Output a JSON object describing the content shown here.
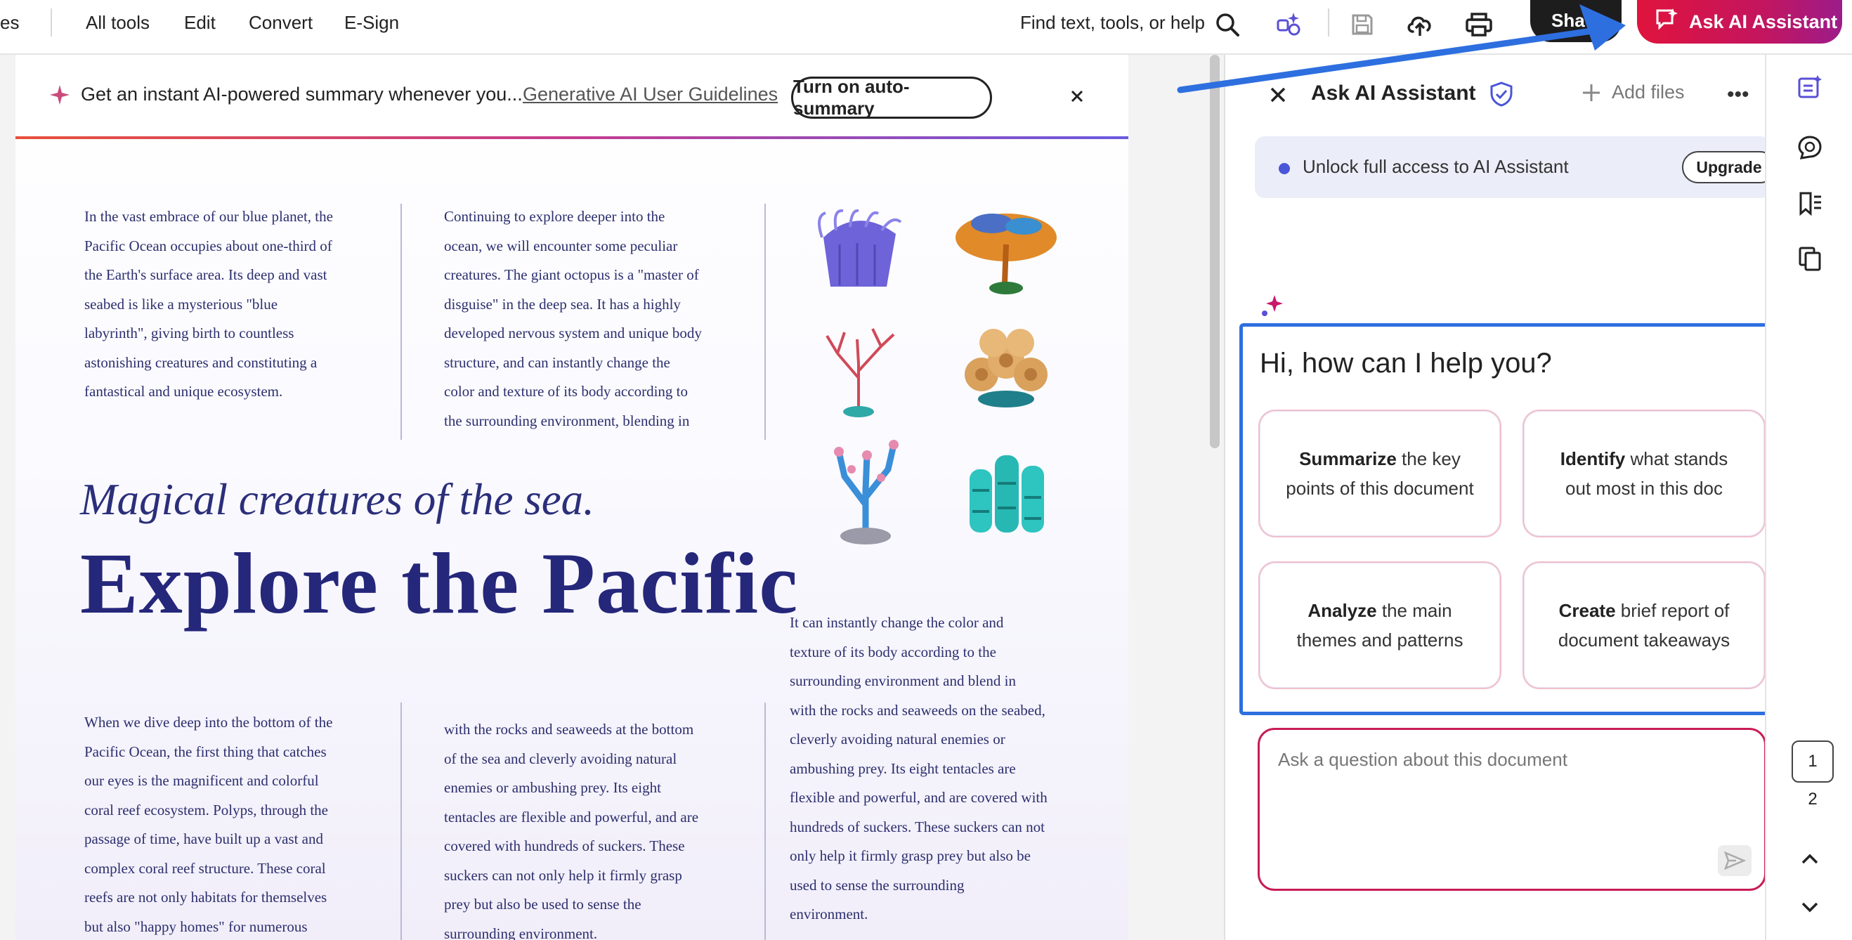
{
  "topbar": {
    "cut_tab": "es",
    "menu": [
      "All tools",
      "Edit",
      "Convert",
      "E-Sign"
    ],
    "search_text": "Find text, tools, or help",
    "share_label": "Sha",
    "ai_label": "Ask AI Assistant",
    "icons": [
      "search-icon",
      "ai-tools-icon",
      "save-icon",
      "upload-icon",
      "print-icon",
      "ai-chat-icon"
    ]
  },
  "banner": {
    "message": "Get an instant AI-powered summary whenever you...",
    "link": "Generative AI User Guidelines",
    "button": "Turn on auto-summary"
  },
  "document": {
    "col1_lines": [
      "In the vast embrace of our blue planet, the",
      "Pacific Ocean occupies about one-third of",
      "the Earth's surface area. Its deep and vast",
      "seabed is like a mysterious \"blue",
      "labyrinth\", giving birth to countless",
      "astonishing creatures and constituting a",
      "fantastical and unique ecosystem."
    ],
    "col2_lines": [
      "Continuing to explore deeper into the",
      "ocean, we will encounter some peculiar",
      "creatures. The giant octopus is a \"master of",
      "disguise\" in the deep sea. It has a highly",
      "developed nervous system and unique body",
      "structure, and can instantly change the",
      "color and texture of its body according to",
      "the surrounding environment, blending in"
    ],
    "subtitle": "Magical creatures of the sea.",
    "title": "Explore the Pacific",
    "col3_lines": [
      "It can instantly change the color and",
      "texture of its body according to the",
      "surrounding environment and blend in",
      "with the rocks and seaweeds on the seabed,",
      "cleverly avoiding natural enemies or",
      "ambushing prey. Its eight tentacles are",
      "flexible and powerful, and are covered with",
      "hundreds of suckers. These suckers can not",
      "only help it firmly grasp prey but also be",
      "used to sense the surrounding",
      "environment."
    ],
    "col4_lines": [
      "When we dive deep into the bottom of the",
      "Pacific Ocean, the first thing that catches",
      "our eyes is the magnificent and colorful",
      "coral reef ecosystem. Polyps, through the",
      "passage of time, have built up a vast and",
      "complex coral reef structure. These coral",
      "reefs are not only habitats for themselves",
      "but also \"happy homes\" for numerous"
    ],
    "col5_lines": [
      "with the rocks and seaweeds at the bottom",
      "of the sea and cleverly avoiding natural",
      "enemies or ambushing prey. Its eight",
      "tentacles are flexible and powerful, and are",
      "covered with hundreds of suckers. These",
      "suckers can not only help it firmly grasp",
      "prey but also be used to sense the",
      "surrounding environment."
    ]
  },
  "panel": {
    "title": "Ask AI Assistant",
    "add_files": "Add files",
    "more": "•••",
    "unlock_text": "Unlock full access to AI Assistant",
    "upgrade": "Upgrade",
    "greeting": "Hi, how can I help you?",
    "cards": [
      {
        "bold": "Summarize",
        "rest1": " the key",
        "line2": "points of this document"
      },
      {
        "bold": "Identify",
        "rest1": " what stands",
        "line2": "out most in this doc"
      },
      {
        "bold": "Analyze",
        "rest1": " the main",
        "line2": "themes and patterns"
      },
      {
        "bold": "Create",
        "rest1": " brief report of",
        "line2": "document takeaways"
      }
    ],
    "ask_placeholder": "Ask a question about this document"
  },
  "rail": {
    "page_current": "1",
    "page_next": "2",
    "icons": [
      "ai-summary-icon",
      "comment-icon",
      "bookmark-icon",
      "pages-icon",
      "chevron-up-icon",
      "chevron-down-icon"
    ]
  },
  "colors": {
    "accent_blue": "#2e6fe0",
    "ai_red": "#e0143d",
    "title_navy": "#25277a"
  }
}
